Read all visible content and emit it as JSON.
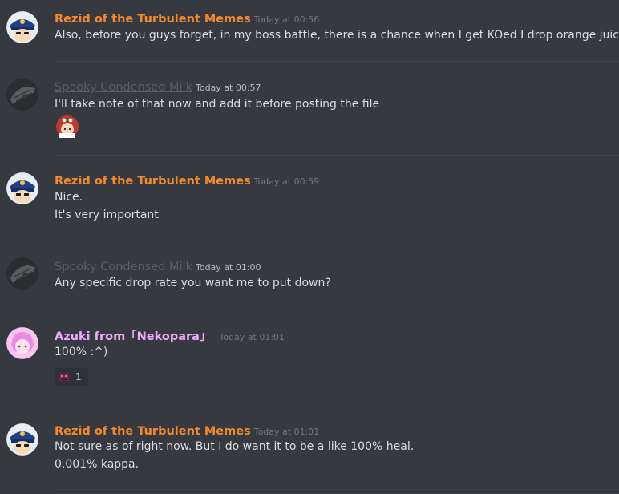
{
  "colors": {
    "background": "#36393f",
    "rezid": "#f58a2c",
    "spooky": "#5b5e64",
    "azuki": "#f3a8ff",
    "text": "#dcddde",
    "timestamp": "#72767d"
  },
  "messages": [
    {
      "author": "Rezid of the Turbulent Memes",
      "timestamp": "Today at 00:56",
      "avatar_icon": "captain-avatar",
      "lines": [
        "Also, before you guys forget, in my boss battle, there is a chance when I get KOed I drop orange juice."
      ]
    },
    {
      "author": "Spooky Condensed Milk",
      "timestamp": "Today at 00:57",
      "avatar_icon": "glove-avatar",
      "lines": [
        "I'll take note of that now and add it before posting the file"
      ],
      "sticker": "red-hair-girl-emoji"
    },
    {
      "author": "Rezid of the Turbulent Memes",
      "timestamp": "Today at 00:59",
      "avatar_icon": "captain-avatar",
      "lines": [
        "Nice.",
        "It's very important"
      ]
    },
    {
      "author": "Spooky Condensed Milk",
      "timestamp": "Today at 01:00",
      "avatar_icon": "glove-avatar",
      "lines": [
        "Any specific drop rate you want me to put down?"
      ]
    },
    {
      "author": "Azuki from「Nekopara」",
      "timestamp": "Today at 01:01",
      "avatar_icon": "pink-girl-avatar",
      "lines": [
        "100% :^)"
      ],
      "reaction": {
        "emoji": "pixel-creature-emoji",
        "count": "1"
      }
    },
    {
      "author": "Rezid of the Turbulent Memes",
      "timestamp": "Today at 01:01",
      "avatar_icon": "captain-avatar",
      "lines": [
        "Not sure as of right now. But I do want it to be a like 100% heal.",
        "0.001% kappa."
      ]
    }
  ]
}
